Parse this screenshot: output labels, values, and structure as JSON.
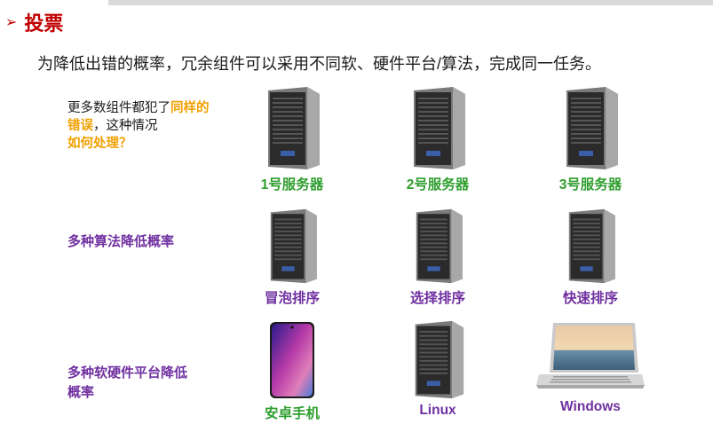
{
  "slide": {
    "title_arrow": "➢",
    "title": "投票",
    "subtitle": "为降低出错的概率，冗余组件可以采用不同软、硬件平台/算法，完成同一任务。"
  },
  "question": {
    "part1": "更多数组件都犯了",
    "highlight1": "同样的错误",
    "part2": "，这种情况",
    "highlight2": "如何处理？"
  },
  "rows": [
    {
      "label": "",
      "items": [
        {
          "label": "1号服务器",
          "icon": "server-tower-icon"
        },
        {
          "label": "2号服务器",
          "icon": "server-tower-icon"
        },
        {
          "label": "3号服务器",
          "icon": "server-tower-icon"
        }
      ]
    },
    {
      "label": "多种算法降低概率",
      "items": [
        {
          "label": "冒泡排序",
          "icon": "server-tower-icon"
        },
        {
          "label": "选择排序",
          "icon": "server-tower-icon"
        },
        {
          "label": "快速排序",
          "icon": "server-tower-icon"
        }
      ]
    },
    {
      "label": "多种软硬件平台降低概率",
      "label_line1": "多种软硬件平台降低",
      "label_line2": "概率",
      "items": [
        {
          "label": "安卓手机",
          "icon": "smartphone-icon"
        },
        {
          "label": "Linux",
          "icon": "server-tower-icon"
        },
        {
          "label": "Windows",
          "icon": "laptop-icon"
        }
      ]
    }
  ],
  "colors": {
    "title": "#c00000",
    "green_label": "#2e9e2e",
    "purple_label": "#7030a0",
    "orange_highlight": "#f0a000"
  }
}
